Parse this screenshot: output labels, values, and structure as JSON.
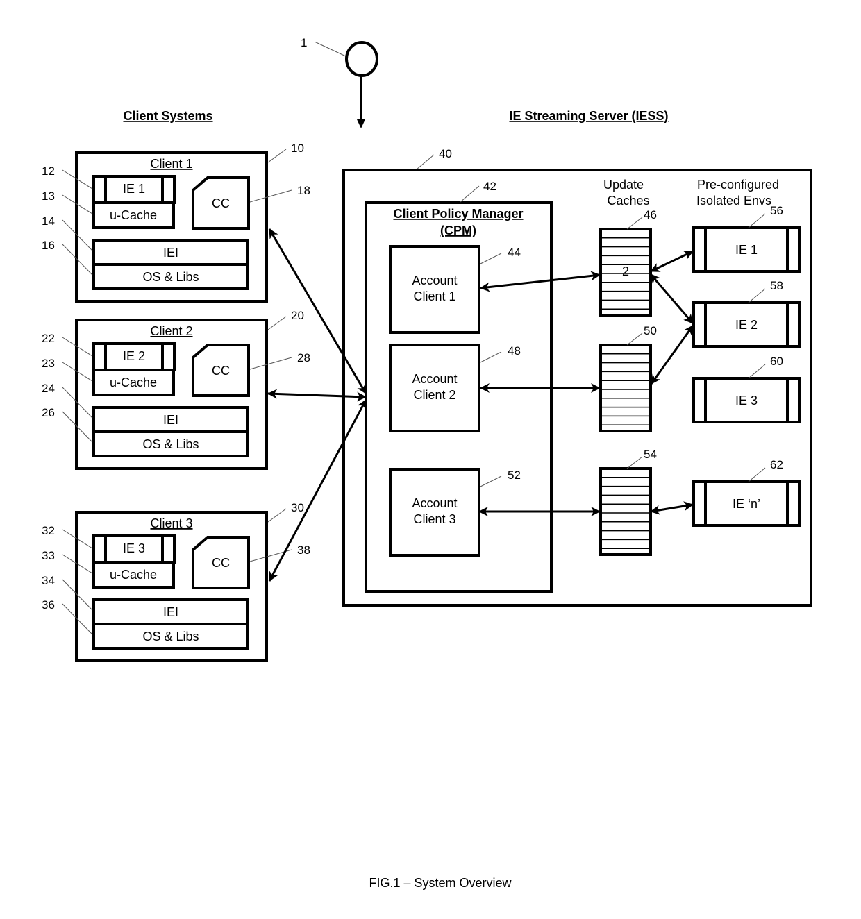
{
  "figure": {
    "caption": "FIG.1  – System Overview",
    "origin_ref": "1"
  },
  "headings": {
    "clients": "Client Systems",
    "server": "IE Streaming Server (IESS)"
  },
  "clients": [
    {
      "title": "Client 1",
      "ref": "10",
      "ie_label": "IE 1",
      "ie_ref": "12",
      "ucache_label": "u-Cache",
      "ucache_ref": "13",
      "iei_label": "IEI",
      "iei_ref": "14",
      "os_label": "OS & Libs",
      "os_ref": "16",
      "cc_label": "CC",
      "cc_ref": "18"
    },
    {
      "title": "Client 2",
      "ref": "20",
      "ie_label": "IE 2",
      "ie_ref": "22",
      "ucache_label": "u-Cache",
      "ucache_ref": "23",
      "iei_label": "IEI",
      "iei_ref": "24",
      "os_label": "OS & Libs",
      "os_ref": "26",
      "cc_label": "CC",
      "cc_ref": "28"
    },
    {
      "title": "Client 3",
      "ref": "30",
      "ie_label": "IE 3",
      "ie_ref": "32",
      "ucache_label": "u-Cache",
      "ucache_ref": "33",
      "iei_label": "IEI",
      "iei_ref": "34",
      "os_label": "OS & Libs",
      "os_ref": "36",
      "cc_label": "CC",
      "cc_ref": "38"
    }
  ],
  "server": {
    "ref": "40",
    "cpm": {
      "title_line1": "Client Policy Manager",
      "title_line2": "(CPM)",
      "ref": "42",
      "accounts": [
        {
          "line1": "Account",
          "line2": "Client 1",
          "ref": "44"
        },
        {
          "line1": "Account",
          "line2": "Client  2",
          "ref": "48"
        },
        {
          "line1": "Account",
          "line2": "Client 3",
          "ref": "52"
        }
      ]
    },
    "update_caches": {
      "heading_line1": "Update",
      "heading_line2": "Caches",
      "items": [
        {
          "ref": "46",
          "label": "2"
        },
        {
          "ref": "50",
          "label": ""
        },
        {
          "ref": "54",
          "label": ""
        }
      ]
    },
    "isolated_envs": {
      "heading_line1": "Pre-configured",
      "heading_line2": "Isolated Envs",
      "items": [
        {
          "label": "IE 1",
          "ref": "56"
        },
        {
          "label": "IE 2",
          "ref": "58"
        },
        {
          "label": "IE 3",
          "ref": "60"
        },
        {
          "label": "IE ‘n’",
          "ref": "62"
        }
      ]
    }
  }
}
